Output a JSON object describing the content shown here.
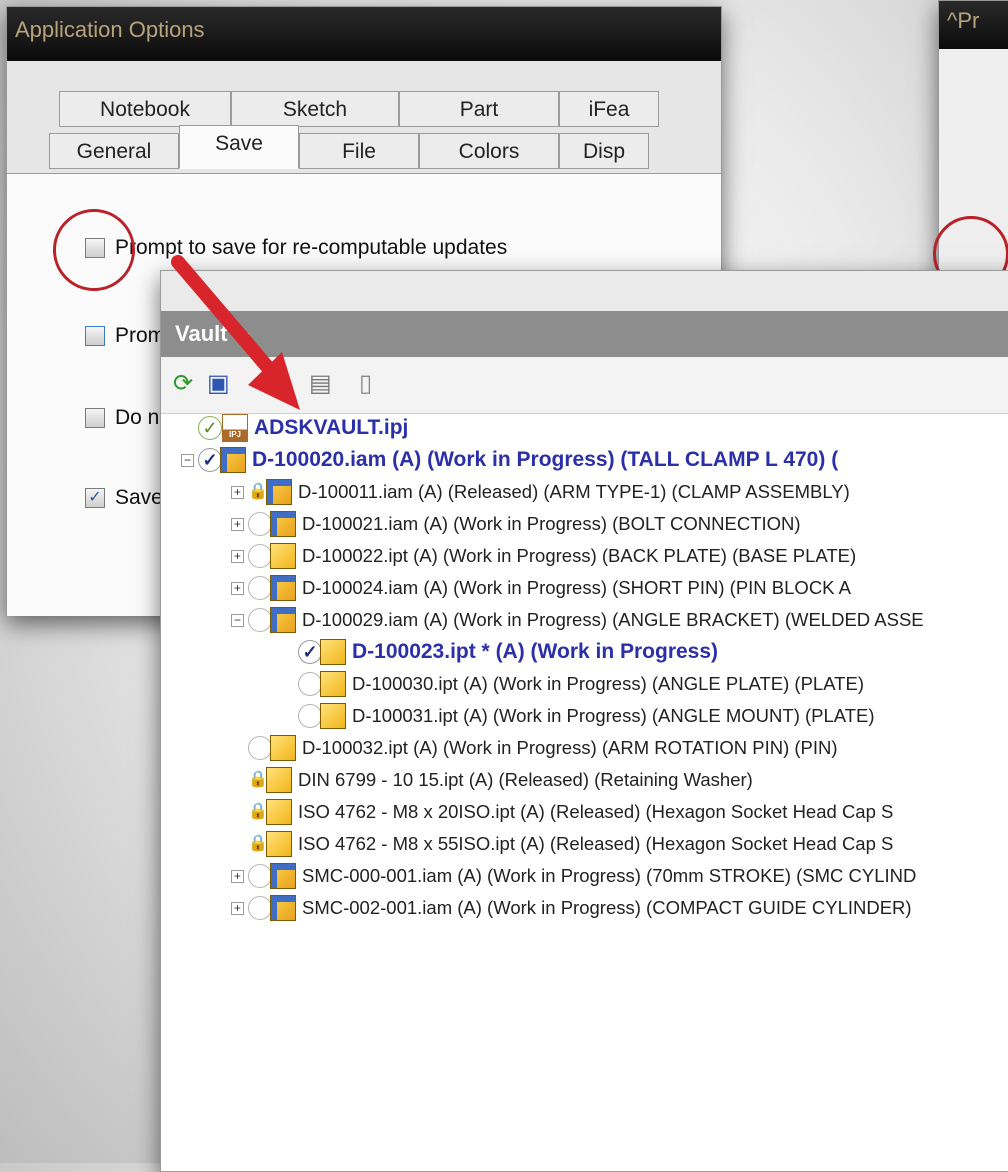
{
  "app_options": {
    "title": "Application Options",
    "tabs_row1": [
      "Notebook",
      "Sketch",
      "Part",
      "iFea"
    ],
    "tabs_row2": [
      "General",
      "Save",
      "File",
      "Colors",
      "Disp"
    ],
    "active_tab": "Save",
    "options": [
      {
        "label": "Prompt to save for re-computable updates",
        "checked": false
      },
      {
        "label": "Prom",
        "checked": false
      },
      {
        "label": "Do n",
        "checked": false
      },
      {
        "label": "Save",
        "checked": true
      }
    ]
  },
  "right_window": {
    "title": "^Pr"
  },
  "vault": {
    "header": "Vault",
    "toolbar_icons": [
      "refresh-icon",
      "check-in-icon",
      "thumbnail-icon",
      "sheet-icon"
    ],
    "tree": [
      {
        "label": "ADSKVAULT.ipj",
        "status": "ok",
        "kind": "ipj",
        "level": 0,
        "expander": "",
        "bold": true
      },
      {
        "label": "D-100020.iam (A) (Work in Progress) (TALL CLAMP L 470) (",
        "status": "check",
        "kind": "asm",
        "level": 0,
        "expander": "−",
        "bold": true
      },
      {
        "label": "D-100011.iam (A) (Released) (ARM TYPE-1) (CLAMP ASSEMBLY)",
        "status": "lock",
        "kind": "asm",
        "level": 1,
        "expander": "+"
      },
      {
        "label": "D-100021.iam (A) (Work in Progress) (BOLT CONNECTION)",
        "status": "none",
        "kind": "asm",
        "level": 1,
        "expander": "+"
      },
      {
        "label": "D-100022.ipt (A) (Work in Progress) (BACK PLATE) (BASE PLATE)",
        "status": "none",
        "kind": "part",
        "level": 1,
        "expander": "+"
      },
      {
        "label": "D-100024.iam (A) (Work in Progress) (SHORT PIN) (PIN BLOCK A",
        "status": "none",
        "kind": "asm",
        "level": 1,
        "expander": "+"
      },
      {
        "label": "D-100029.iam (A) (Work in Progress) (ANGLE BRACKET) (WELDED ASSE",
        "status": "none",
        "kind": "asm",
        "level": 1,
        "expander": "−"
      },
      {
        "label": "D-100023.ipt * (A) (Work in Progress)",
        "status": "check",
        "kind": "part",
        "level": 2,
        "expander": "",
        "bold": true
      },
      {
        "label": "D-100030.ipt (A) (Work in Progress) (ANGLE PLATE) (PLATE)",
        "status": "none",
        "kind": "part",
        "level": 2,
        "expander": ""
      },
      {
        "label": "D-100031.ipt (A) (Work in Progress) (ANGLE MOUNT) (PLATE)",
        "status": "none",
        "kind": "part",
        "level": 2,
        "expander": ""
      },
      {
        "label": "D-100032.ipt (A) (Work in Progress) (ARM ROTATION PIN) (PIN)",
        "status": "none",
        "kind": "part",
        "level": 1,
        "expander": ""
      },
      {
        "label": "DIN 6799 - 10 15.ipt (A) (Released) (Retaining Washer)",
        "status": "lock",
        "kind": "part",
        "level": 1,
        "expander": ""
      },
      {
        "label": "ISO 4762 - M8 x 20ISO.ipt (A) (Released) (Hexagon Socket Head Cap S",
        "status": "lock",
        "kind": "part",
        "level": 1,
        "expander": ""
      },
      {
        "label": "ISO 4762 - M8 x 55ISO.ipt (A) (Released) (Hexagon Socket Head Cap S",
        "status": "lock",
        "kind": "part",
        "level": 1,
        "expander": ""
      },
      {
        "label": "SMC-000-001.iam (A) (Work in Progress) (70mm STROKE) (SMC CYLIND",
        "status": "none",
        "kind": "asm",
        "level": 1,
        "expander": "+"
      },
      {
        "label": "SMC-002-001.iam (A) (Work in Progress) (COMPACT GUIDE CYLINDER)",
        "status": "none",
        "kind": "asm",
        "level": 1,
        "expander": "+"
      }
    ]
  },
  "colors": {
    "annotation_red": "#d8242b",
    "vault_header": "#8d8d8d",
    "bold_item": "#2b2fa8"
  }
}
